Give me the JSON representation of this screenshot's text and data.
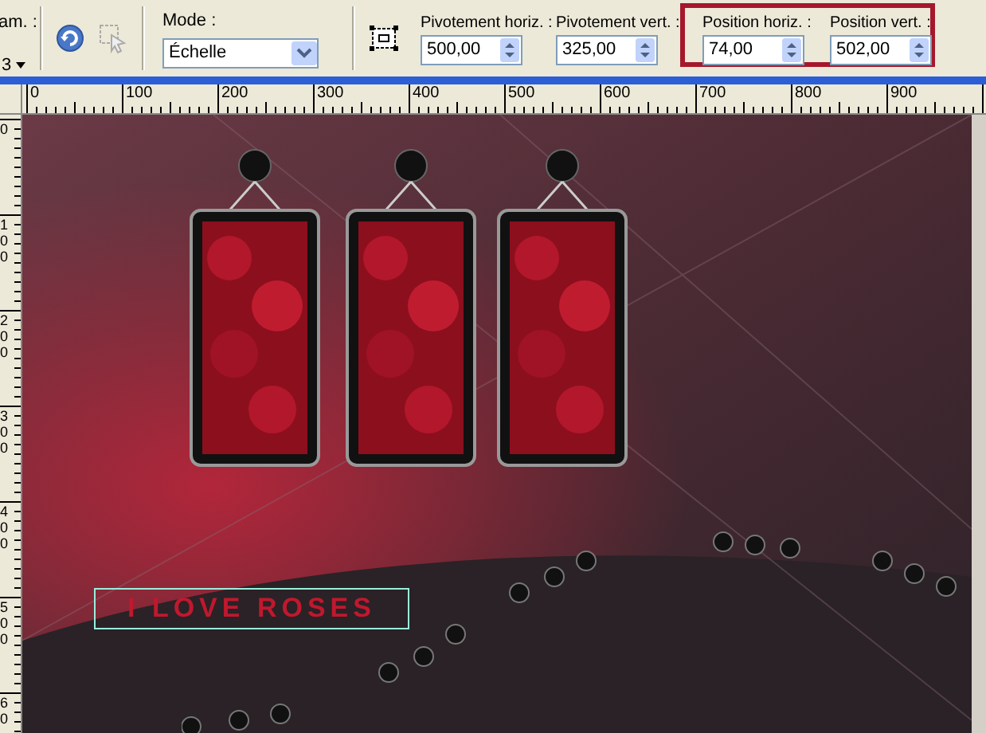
{
  "toolbar": {
    "partial_label": "am. :",
    "partial_value": "3",
    "mode": {
      "label": "Mode :",
      "value": "Échelle"
    },
    "groups": [
      {
        "highlighted": false,
        "fields": [
          {
            "label": "Pivotement horiz. :",
            "value": "500,00"
          },
          {
            "label": "Pivotement vert. :",
            "value": "325,00"
          }
        ]
      },
      {
        "highlighted": true,
        "fields": [
          {
            "label": "Position horiz. :",
            "value": "74,00"
          },
          {
            "label": "Position vert. :",
            "value": "502,00"
          }
        ]
      }
    ]
  },
  "rulers": {
    "horizontal": [
      "0",
      "100",
      "200",
      "300",
      "400",
      "500",
      "600",
      "700",
      "800",
      "900"
    ],
    "vertical": [
      "0",
      "100",
      "200",
      "300",
      "400",
      "500",
      "60"
    ]
  },
  "canvas": {
    "title_text": "I LOVE ROSES"
  }
}
